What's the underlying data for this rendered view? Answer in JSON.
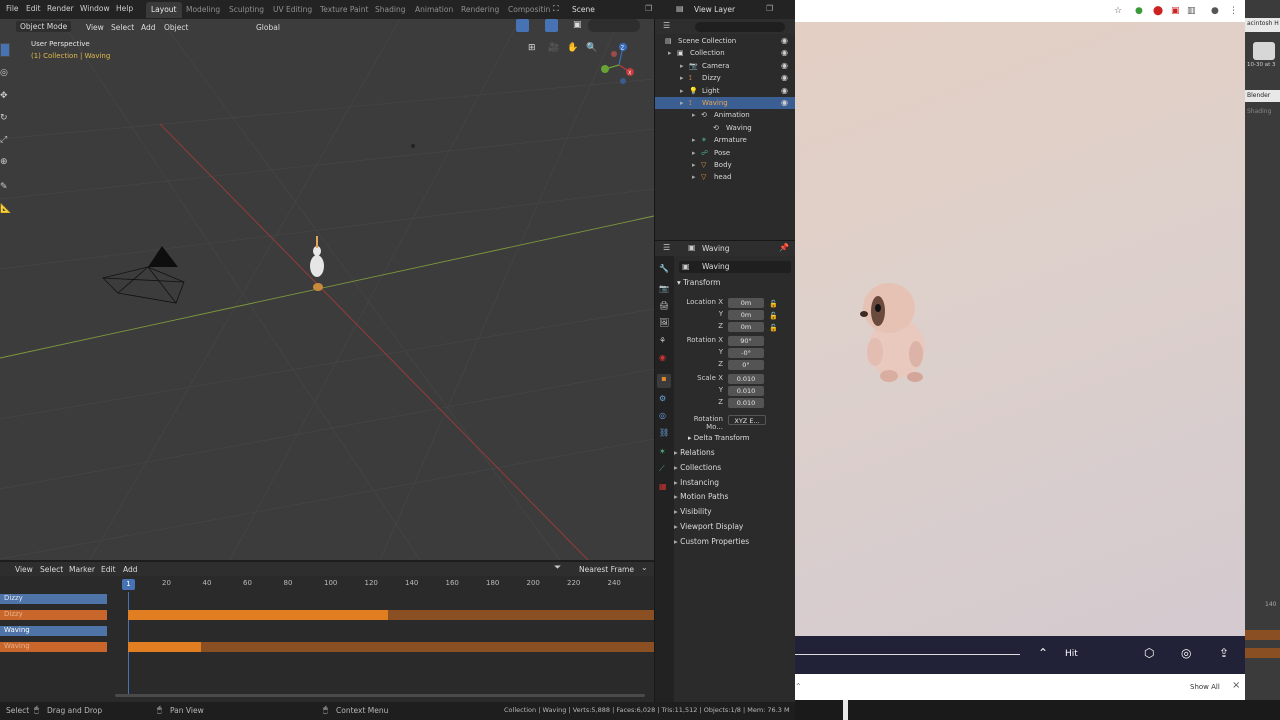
{
  "blender": {
    "menus": [
      "File",
      "Edit",
      "Render",
      "Window",
      "Help"
    ],
    "workspaces": [
      "Layout",
      "Modeling",
      "Sculpting",
      "UV Editing",
      "Texture Paint",
      "Shading",
      "Animation",
      "Rendering",
      "Compositin"
    ],
    "active_workspace": "Layout",
    "scene": "Scene",
    "view_layer": "View Layer",
    "viewport": {
      "mode": "Object Mode",
      "menus": [
        "View",
        "Select",
        "Add",
        "Object"
      ],
      "orientation": "Global",
      "perspective_label": "User Perspective",
      "collection_label": "(1) Collection | Waving",
      "gizmo_axes": [
        "Y",
        "Z",
        "X"
      ]
    },
    "outliner": {
      "rows": [
        {
          "label": "Scene Collection",
          "indent": 0,
          "icon": "scene-collection-icon"
        },
        {
          "label": "Collection",
          "indent": 1,
          "icon": "collection-icon"
        },
        {
          "label": "Camera",
          "indent": 2,
          "icon": "camera-icon"
        },
        {
          "label": "Dizzy",
          "indent": 2,
          "icon": "armature-icon"
        },
        {
          "label": "Light",
          "indent": 2,
          "icon": "light-icon"
        },
        {
          "label": "Waving",
          "indent": 2,
          "icon": "armature-icon",
          "selected": true
        },
        {
          "label": "Animation",
          "indent": 3,
          "icon": "animation-icon"
        },
        {
          "label": "Waving",
          "indent": 4,
          "icon": "action-icon"
        },
        {
          "label": "Armature",
          "indent": 3,
          "icon": "armature-data-icon"
        },
        {
          "label": "Pose",
          "indent": 3,
          "icon": "pose-icon"
        },
        {
          "label": "Body",
          "indent": 3,
          "icon": "mesh-icon"
        },
        {
          "label": "head",
          "indent": 3,
          "icon": "mesh-icon"
        }
      ]
    },
    "properties": {
      "header": "Waving",
      "object_name": "Waving",
      "transform_label": "Transform",
      "location_label": "Location X",
      "rotation_label": "Rotation X",
      "scale_label": "Scale X",
      "location": [
        "0m",
        "0m",
        "0m"
      ],
      "rotation": [
        "90°",
        "-0°",
        "0°"
      ],
      "scale": [
        "0.010",
        "0.010",
        "0.010"
      ],
      "axis_labels": [
        "Y",
        "Z"
      ],
      "rotation_mode_label": "Rotation Mo...",
      "rotation_mode": "XYZ E...",
      "delta_transform": "Delta Transform",
      "panels": [
        "Relations",
        "Collections",
        "Instancing",
        "Motion Paths",
        "Visibility",
        "Viewport Display",
        "Custom Properties"
      ]
    },
    "timeline": {
      "menus": [
        "View",
        "Select",
        "Marker",
        "Edit",
        "Add"
      ],
      "snap": "Nearest Frame",
      "current_frame": "1",
      "ticks": [
        "20",
        "40",
        "60",
        "80",
        "100",
        "120",
        "140",
        "160",
        "180",
        "200",
        "220",
        "240"
      ],
      "tracks": [
        "Dizzy",
        "Dizzy",
        "Waving",
        "Waving"
      ]
    },
    "status": {
      "select": "Select",
      "drag": "Drag and Drop",
      "pan": "Pan View",
      "context": "Context Menu",
      "stats": "Collection | Waving | Verts:5,888 | Faces:6,028 | Tris:11,512 | Objects:1/8 | Mem: 76.3 M"
    }
  },
  "browser": {
    "bottom_label": "Hit",
    "show_all": "Show All",
    "close": "×"
  },
  "right_strip": {
    "labels": [
      "acintosh H",
      "10-30 at 3",
      "Blender",
      "Shading",
      "140"
    ]
  },
  "colors": {
    "accent": "#4772b3",
    "orange": "#c8662b",
    "select_blue": "#3c5f93"
  }
}
